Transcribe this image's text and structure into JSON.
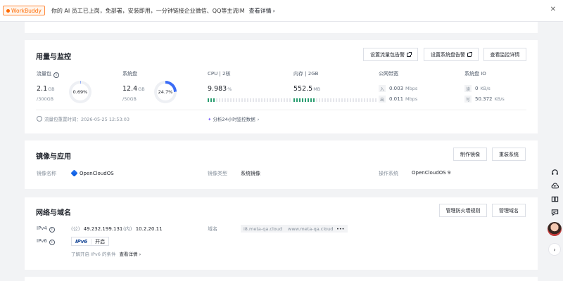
{
  "topbar": {
    "badge": "WorkBuddy",
    "notice": "你的 AI 员工已上岗，免部署，安装即用，一分钟链接企业微信、QQ等主流IM",
    "link": "查看详情",
    "chevron": "›",
    "close": "✕"
  },
  "usage": {
    "title": "用量与监控",
    "btn_traffic_alert": "设置流量包告警",
    "btn_disk_alert": "设置系统盘告警",
    "btn_monitor": "查看监控详情",
    "traffic": {
      "label": "流量包",
      "info": "i",
      "value": "2.1",
      "unit": "GB",
      "total": "/300GB",
      "percent": "0.69%",
      "fraction": 0.0069
    },
    "disk": {
      "label": "系统盘",
      "value": "12.4",
      "unit": "GB",
      "total": "/50GB",
      "percent": "24.7%",
      "fraction": 0.247
    },
    "cpu": {
      "label": "CPU | 2核",
      "value": "9.983",
      "unit": "%",
      "fraction": 0.1
    },
    "mem": {
      "label": "内存 | 2GB",
      "value": "552.5",
      "unit": "MB",
      "fraction": 0.27
    },
    "bandwidth": {
      "label": "公网带宽",
      "in_icon": "入",
      "in_value": "0.003",
      "in_unit": "Mbps",
      "out_icon": "出",
      "out_value": "0.011",
      "out_unit": "Mbps"
    },
    "diskio": {
      "label": "系统盘 IO",
      "read_icon": "读",
      "read_value": "0",
      "read_unit": "KB/s",
      "write_icon": "写",
      "write_value": "50.372",
      "write_unit": "KB/s"
    },
    "reset_time": "流量包重置时间：2026-05-25 12:53:03",
    "analyze": "分析24小时监控数据",
    "analyze_chev": "›"
  },
  "image": {
    "title": "镜像与应用",
    "btn_make": "制作镜像",
    "btn_reinstall": "重装系统",
    "name_label": "镜像名称",
    "name_value": "OpenCloudOS",
    "type_label": "镜像类型",
    "type_value": "系统镜像",
    "os_label": "操作系统",
    "os_value": "OpenCloudOS 9"
  },
  "network": {
    "title": "网络与域名",
    "btn_firewall": "管理防火墙规则",
    "btn_domain": "管理域名",
    "ipv4_label": "IPv4",
    "public_tag": "(公)",
    "public_ip": "49.232.199.131",
    "private_tag": "(内)",
    "private_ip": "10.2.20.11",
    "ipv6_label": "IPv6",
    "ipv6_logo": "IPv6",
    "ipv6_status": "开启",
    "ipv6_hint": "了解开启 IPv6 的条件",
    "ipv6_link": "查看详情",
    "domain_label": "域名",
    "domain1": "i8.meta-qa.cloud",
    "domain2": "www.meta-qa.cloud",
    "domain_more": "•••"
  },
  "sidebar": {
    "icons": [
      "headset-icon",
      "cloud-upload-icon",
      "book-icon",
      "chat-icon"
    ],
    "next": "›"
  }
}
